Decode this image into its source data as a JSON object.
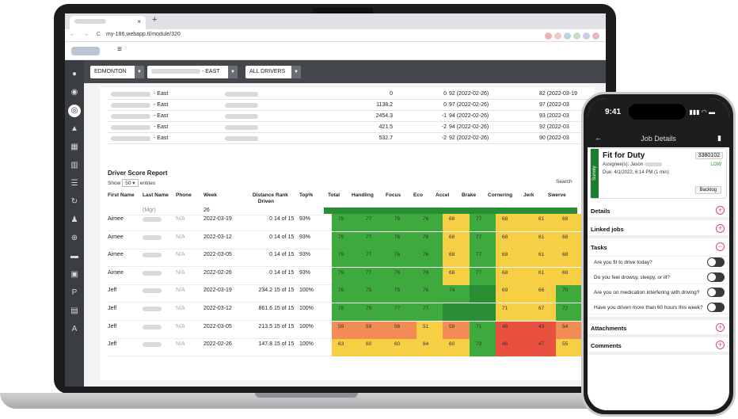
{
  "browser": {
    "tab_close": "×",
    "new_tab": "+",
    "nav": "← → C",
    "url": "my-186.webapp.tl/module/320",
    "ham": "≡"
  },
  "filters": {
    "city": "EDMONTON",
    "region": "- EAST",
    "drivers": "ALL DRIVERS"
  },
  "top_rows": [
    {
      "region": "- East",
      "dist": "0",
      "delta": "0",
      "score": "92 (2022-02-26)",
      "score2": "82 (2022-03-19"
    },
    {
      "region": "- East",
      "dist": "1138.2",
      "delta": "0",
      "score": "97 (2022-02-26)",
      "score2": "97 (2022-03"
    },
    {
      "region": "- East",
      "dist": "2454.3",
      "delta": "-1",
      "score": "94 (2022-02-26)",
      "score2": "93 (2022-03"
    },
    {
      "region": "- East",
      "dist": "421.5",
      "delta": "-2",
      "score": "94 (2022-02-26)",
      "score2": "92 (2022-03"
    },
    {
      "region": "- East",
      "dist": "532.7",
      "delta": "-2",
      "score": "92 (2022-02-26)",
      "score2": "90 (2022-03"
    }
  ],
  "report": {
    "title": "Driver Score Report",
    "show": "Show",
    "show_val": "50",
    "entries": "entries",
    "search": "Search",
    "headers": [
      "First Name",
      "Last Name",
      "Phone",
      "Week",
      "Distance Driven",
      "Rank",
      "Top%",
      "Total",
      "Handling",
      "Focus",
      "Eco",
      "Accel",
      "Brake",
      "Cornering",
      "Jerk",
      "Swerve"
    ],
    "partial_week": "26",
    "partial_mgr": "(Mgr)",
    "rows": [
      {
        "first": "Aimee",
        "phone": "N/A",
        "week": "2022-03-19",
        "dist": "0",
        "rank": "14 of 15",
        "top": "93%",
        "vals": [
          "79",
          "77",
          "76",
          "76",
          "68",
          "77",
          "68",
          "61",
          "68"
        ],
        "colors": [
          "g",
          "g",
          "g",
          "g",
          "y",
          "g",
          "y",
          "y",
          "y"
        ]
      },
      {
        "first": "Aimee",
        "phone": "N/A",
        "week": "2022-03-12",
        "dist": "0",
        "rank": "14 of 15",
        "top": "93%",
        "vals": [
          "79",
          "77",
          "76",
          "76",
          "68",
          "77",
          "68",
          "61",
          "68"
        ],
        "colors": [
          "g",
          "g",
          "g",
          "g",
          "y",
          "g",
          "y",
          "y",
          "y"
        ]
      },
      {
        "first": "Aimee",
        "phone": "N/A",
        "week": "2022-03-05",
        "dist": "0",
        "rank": "14 of 15",
        "top": "93%",
        "vals": [
          "79",
          "77",
          "76",
          "76",
          "68",
          "77",
          "68",
          "61",
          "68"
        ],
        "colors": [
          "g",
          "g",
          "g",
          "g",
          "y",
          "g",
          "y",
          "y",
          "y"
        ]
      },
      {
        "first": "Aimee",
        "phone": "N/A",
        "week": "2022-02-26",
        "dist": "0",
        "rank": "14 of 15",
        "top": "93%",
        "vals": [
          "79",
          "77",
          "76",
          "76",
          "68",
          "77",
          "68",
          "61",
          "68"
        ],
        "colors": [
          "g",
          "g",
          "g",
          "g",
          "y",
          "g",
          "y",
          "y",
          "y"
        ]
      },
      {
        "first": "Jeff",
        "phone": "N/A",
        "week": "2022-03-19",
        "dist": "234.2",
        "rank": "15 of 15",
        "top": "100%",
        "vals": [
          "76",
          "75",
          "75",
          "76",
          "74",
          "",
          "69",
          "66",
          "70"
        ],
        "colors": [
          "g",
          "g",
          "g",
          "g",
          "g",
          "dg",
          "y",
          "y",
          "g"
        ]
      },
      {
        "first": "Jeff",
        "phone": "N/A",
        "week": "2022-03-12",
        "dist": "861.6",
        "rank": "15 of 15",
        "top": "100%",
        "vals": [
          "78",
          "79",
          "77",
          "77",
          "",
          "",
          "71",
          "67",
          "72"
        ],
        "colors": [
          "g",
          "g",
          "g",
          "g",
          "dg",
          "dg",
          "y",
          "y",
          "g"
        ]
      },
      {
        "first": "Jeff",
        "phone": "N/A",
        "week": "2022-03-05",
        "dist": "213.5",
        "rank": "15 of 15",
        "top": "100%",
        "vals": [
          "59",
          "59",
          "56",
          "51",
          "59",
          "71",
          "46",
          "43",
          "54"
        ],
        "colors": [
          "o",
          "o",
          "o",
          "y",
          "o",
          "g",
          "rd",
          "rd",
          "o"
        ]
      },
      {
        "first": "Jeff",
        "phone": "N/A",
        "week": "2022-02-26",
        "dist": "147.8",
        "rank": "15 of 15",
        "top": "100%",
        "vals": [
          "63",
          "60",
          "60",
          "64",
          "60",
          "73",
          "46",
          "47",
          "55"
        ],
        "colors": [
          "y",
          "y",
          "y",
          "y",
          "y",
          "g",
          "rd",
          "rd",
          "y"
        ]
      }
    ]
  },
  "phone": {
    "time": "9:41",
    "signal": "▮▮▮ ◠ ▬",
    "back": "←",
    "title": "Job Details",
    "trash": "▮",
    "job": {
      "survey": "Survey",
      "title": "Fit for Duty",
      "number": "3380102",
      "assignee": "Assignee(s):  Jason",
      "priority": "LOW",
      "due": "Due: 4/1/2022, 6:14 PM (1 min)",
      "status": "Backlog"
    },
    "sections": {
      "details": "Details",
      "linked": "Linked jobs",
      "tasks": "Tasks",
      "attachments": "Attachments",
      "comments": "Comments",
      "plus": "+",
      "minus": "−"
    },
    "tasks": [
      "Are you fit to drive today?",
      "Do you feel drowsy, sleepy, or ill?",
      "Are you on medication interfering with driving?",
      "Have you driven more than 60 hours this week?"
    ]
  }
}
